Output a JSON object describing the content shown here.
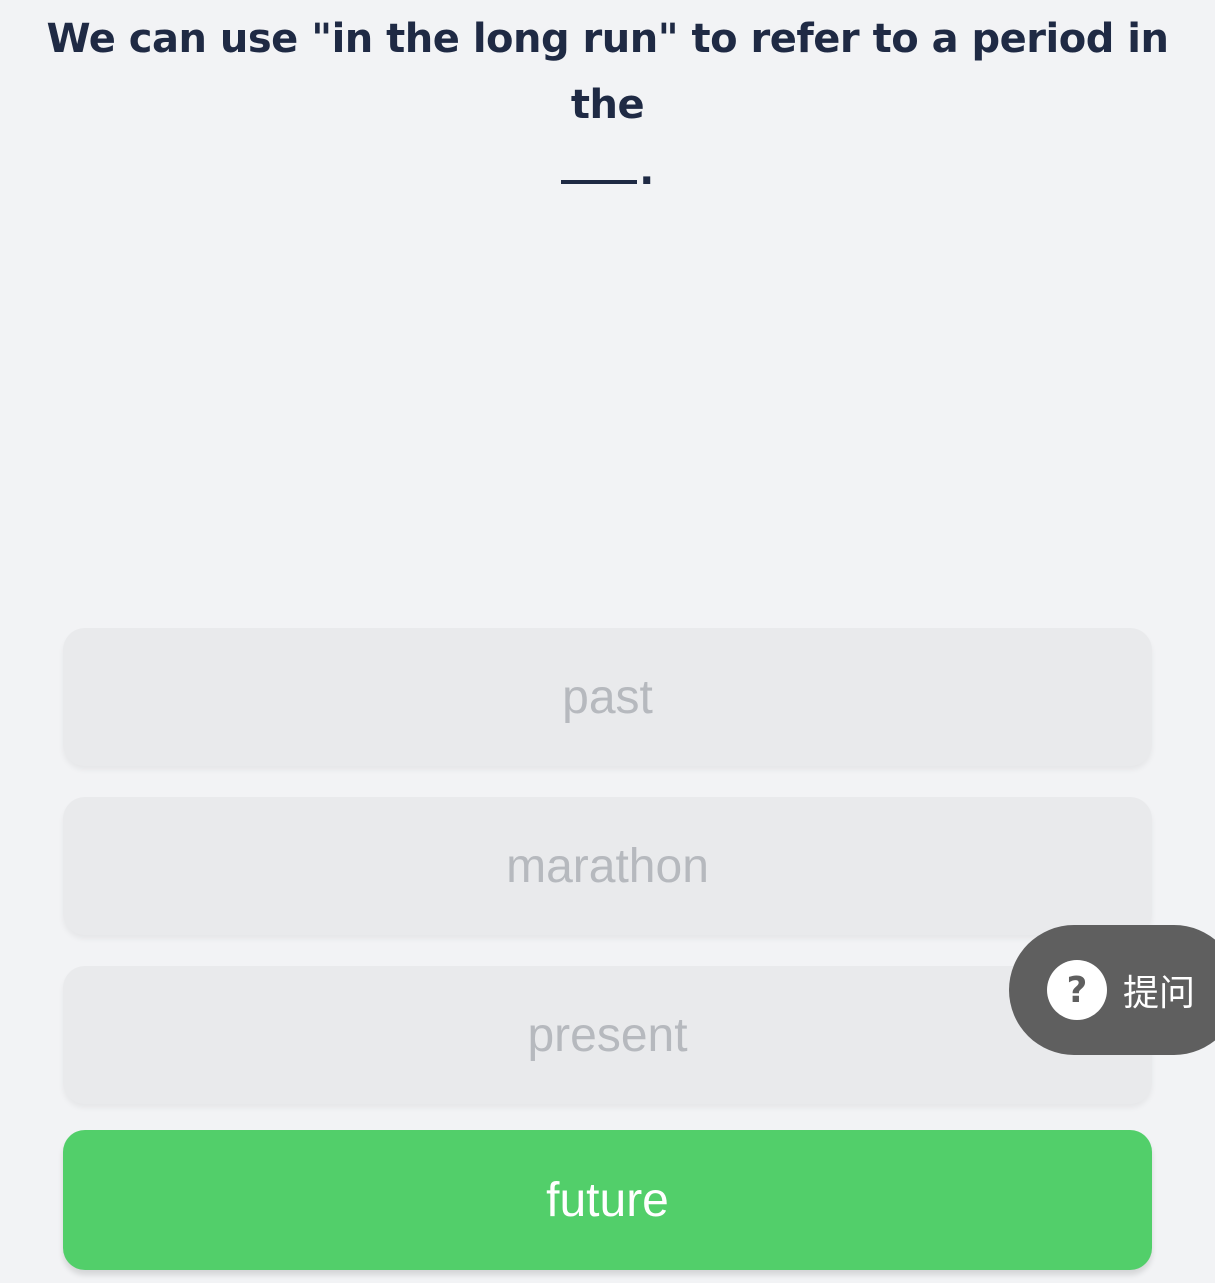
{
  "question": {
    "text": "We can use \"in the long run\" to refer to a period in the",
    "suffix": "."
  },
  "options": [
    {
      "label": "past",
      "state": "default"
    },
    {
      "label": "marathon",
      "state": "default"
    },
    {
      "label": "present",
      "state": "default"
    },
    {
      "label": "future",
      "state": "correct"
    }
  ],
  "ask_button": {
    "icon": "question-circle-icon",
    "label": "提问"
  },
  "colors": {
    "background": "#f2f3f5",
    "option_default": "#e9eaec",
    "option_text_default": "#b6b9be",
    "correct": "#52cf6a",
    "question_text": "#1f2a44",
    "ask_button_bg": "#5f5f5f"
  }
}
